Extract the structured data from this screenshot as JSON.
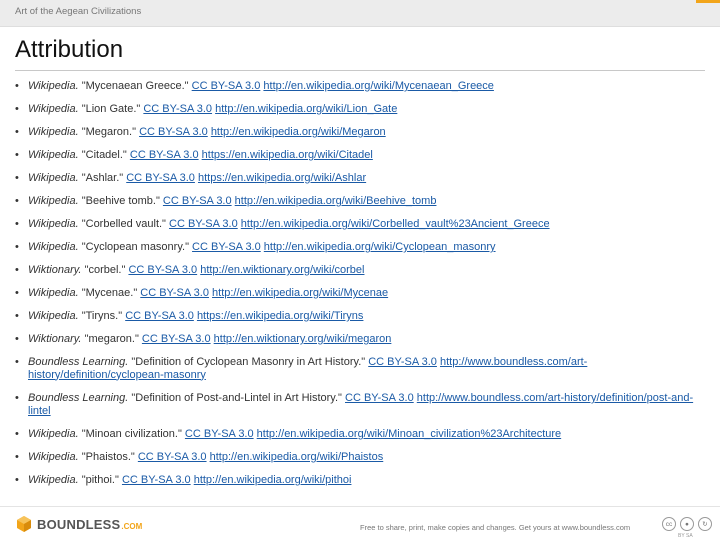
{
  "header": {
    "course_title": "Art of the Aegean Civilizations"
  },
  "slide": {
    "title": "Attribution"
  },
  "references": [
    {
      "source": "Wikipedia.",
      "title": "\"Mycenaean Greece.\"",
      "license": "CC BY-SA 3.0",
      "url": "http://en.wikipedia.org/wiki/Mycenaean_Greece"
    },
    {
      "source": "Wikipedia.",
      "title": "\"Lion Gate.\"",
      "license": "CC BY-SA 3.0",
      "url": "http://en.wikipedia.org/wiki/Lion_Gate"
    },
    {
      "source": "Wikipedia.",
      "title": "\"Megaron.\"",
      "license": "CC BY-SA 3.0",
      "url": "http://en.wikipedia.org/wiki/Megaron"
    },
    {
      "source": "Wikipedia.",
      "title": "\"Citadel.\"",
      "license": "CC BY-SA 3.0",
      "url": "https://en.wikipedia.org/wiki/Citadel"
    },
    {
      "source": "Wikipedia.",
      "title": "\"Ashlar.\"",
      "license": "CC BY-SA 3.0",
      "url": "https://en.wikipedia.org/wiki/Ashlar"
    },
    {
      "source": "Wikipedia.",
      "title": "\"Beehive tomb.\"",
      "license": "CC BY-SA 3.0",
      "url": "http://en.wikipedia.org/wiki/Beehive_tomb"
    },
    {
      "source": "Wikipedia.",
      "title": "\"Corbelled vault.\"",
      "license": "CC BY-SA 3.0",
      "url": "http://en.wikipedia.org/wiki/Corbelled_vault%23Ancient_Greece"
    },
    {
      "source": "Wikipedia.",
      "title": "\"Cyclopean masonry.\"",
      "license": "CC BY-SA 3.0",
      "url": "http://en.wikipedia.org/wiki/Cyclopean_masonry"
    },
    {
      "source": "Wiktionary.",
      "title": "\"corbel.\"",
      "license": "CC BY-SA 3.0",
      "url": "http://en.wiktionary.org/wiki/corbel"
    },
    {
      "source": "Wikipedia.",
      "title": "\"Mycenae.\"",
      "license": "CC BY-SA 3.0",
      "url": "http://en.wikipedia.org/wiki/Mycenae"
    },
    {
      "source": "Wikipedia.",
      "title": "\"Tiryns.\"",
      "license": "CC BY-SA 3.0",
      "url": "https://en.wikipedia.org/wiki/Tiryns"
    },
    {
      "source": "Wiktionary.",
      "title": "\"megaron.\"",
      "license": "CC BY-SA 3.0",
      "url": "http://en.wiktionary.org/wiki/megaron"
    },
    {
      "source": "Boundless Learning.",
      "title": "\"Definition of Cyclopean Masonry in Art History.\"",
      "license": "CC BY-SA 3.0",
      "url": "http://www.boundless.com/art-history/definition/cyclopean-masonry"
    },
    {
      "source": "Boundless Learning.",
      "title": "\"Definition of Post-and-Lintel in Art History.\"",
      "license": "CC BY-SA 3.0",
      "url": "http://www.boundless.com/art-history/definition/post-and-lintel"
    },
    {
      "source": "Wikipedia.",
      "title": "\"Minoan civilization.\"",
      "license": "CC BY-SA 3.0",
      "url": "http://en.wikipedia.org/wiki/Minoan_civilization%23Architecture"
    },
    {
      "source": "Wikipedia.",
      "title": "\"Phaistos.\"",
      "license": "CC BY-SA 3.0",
      "url": "http://en.wikipedia.org/wiki/Phaistos"
    },
    {
      "source": "Wikipedia.",
      "title": "\"pithoi.\"",
      "license": "CC BY-SA 3.0",
      "url": "http://en.wikipedia.org/wiki/pithoi"
    }
  ],
  "footer": {
    "logo_word": "BOUNDLESS",
    "logo_suffix": ".COM",
    "tagline": "Free to share, print, make copies and changes. Get yours at www.boundless.com",
    "cc_badge": "cc",
    "by_badge": "BY",
    "sa_badge": "SA"
  },
  "colors": {
    "accent": "#f2a51a",
    "link": "#1a5aa6",
    "header_bg": "#ececec"
  },
  "icons": {
    "logo": "boundless-logo-icon",
    "cc": "creative-commons-icon"
  }
}
